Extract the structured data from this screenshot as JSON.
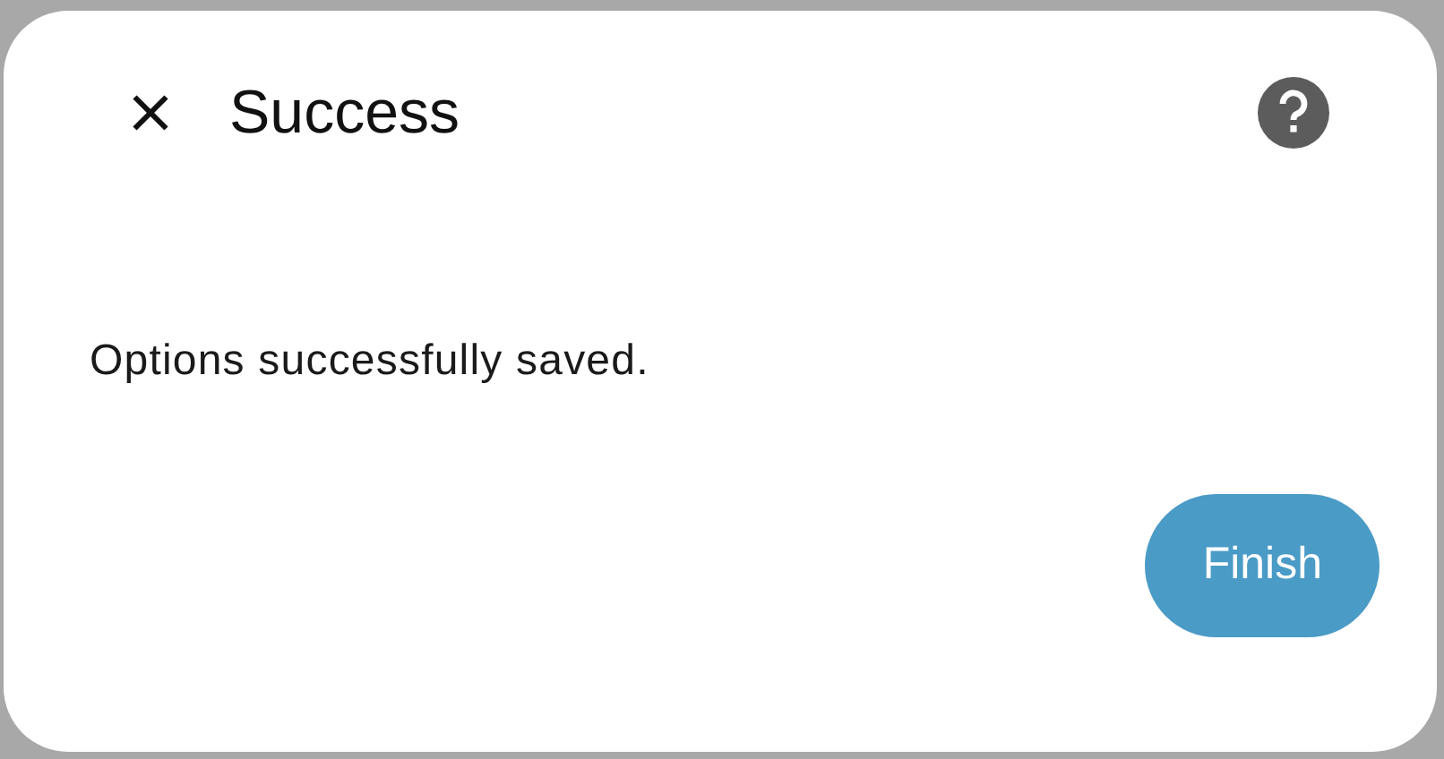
{
  "dialog": {
    "title": "Success",
    "message": "Options successfully saved.",
    "buttons": [
      "Finish"
    ]
  }
}
